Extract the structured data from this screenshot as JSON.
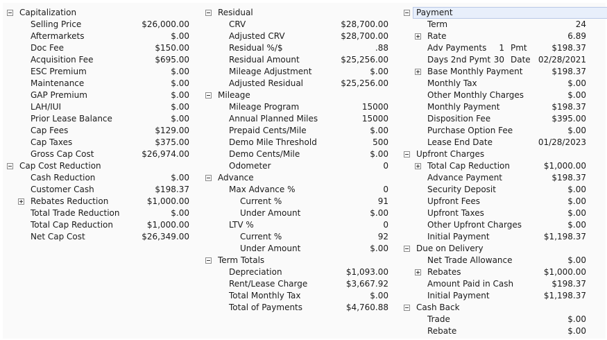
{
  "columns": [
    {
      "rows": [
        {
          "label": "Capitalization",
          "level": 0,
          "toggle": "minus"
        },
        {
          "label": "Selling Price",
          "value": "$26,000.00",
          "level": 1
        },
        {
          "label": "Aftermarkets",
          "value": "$.00",
          "level": 1
        },
        {
          "label": "Doc Fee",
          "value": "$150.00",
          "level": 1
        },
        {
          "label": "Acquisition Fee",
          "value": "$695.00",
          "level": 1
        },
        {
          "label": "ESC Premium",
          "value": "$.00",
          "level": 1
        },
        {
          "label": "Maintenance",
          "value": "$.00",
          "level": 1
        },
        {
          "label": "GAP Premium",
          "value": "$.00",
          "level": 1
        },
        {
          "label": "LAH/IUI",
          "value": "$.00",
          "level": 1
        },
        {
          "label": "Prior Lease Balance",
          "value": "$.00",
          "level": 1
        },
        {
          "label": "Cap Fees",
          "value": "$129.00",
          "level": 1
        },
        {
          "label": "Cap Taxes",
          "value": "$375.00",
          "level": 1
        },
        {
          "label": "Gross Cap Cost",
          "value": "$26,974.00",
          "level": 1
        },
        {
          "label": "Cap Cost Reduction",
          "level": 0,
          "toggle": "minus"
        },
        {
          "label": "Cash Reduction",
          "value": "$.00",
          "level": 1
        },
        {
          "label": "Customer Cash",
          "value": "$198.37",
          "level": 1
        },
        {
          "label": "Rebates Reduction",
          "value": "$1,000.00",
          "level": 1,
          "toggle": "plus"
        },
        {
          "label": "Total Trade Reduction",
          "value": "$.00",
          "level": 1
        },
        {
          "label": "Total Cap Reduction",
          "value": "$1,000.00",
          "level": 1
        },
        {
          "label": "Net Cap Cost",
          "value": "$26,349.00",
          "level": 1
        }
      ]
    },
    {
      "rows": [
        {
          "label": "Residual",
          "level": 0,
          "toggle": "minus"
        },
        {
          "label": "CRV",
          "value": "$28,700.00",
          "level": 1
        },
        {
          "label": "Adjusted CRV",
          "value": "$28,700.00",
          "level": 1
        },
        {
          "label": "Residual %/$",
          "value": ".88",
          "level": 1
        },
        {
          "label": "Residual Amount",
          "value": "$25,256.00",
          "level": 1
        },
        {
          "label": "Mileage Adjustment",
          "value": "$.00",
          "level": 1
        },
        {
          "label": "Adjusted Residual",
          "value": "$25,256.00",
          "level": 1
        },
        {
          "label": "Mileage",
          "level": 0,
          "toggle": "minus"
        },
        {
          "label": "Mileage Program",
          "value": "15000",
          "level": 1
        },
        {
          "label": "Annual Planned Miles",
          "value": "15000",
          "level": 1
        },
        {
          "label": "Prepaid Cents/Mile",
          "value": "$.00",
          "level": 1
        },
        {
          "label": "Demo Mile Threshold",
          "value": "500",
          "level": 1
        },
        {
          "label": "Demo Cents/Mile",
          "value": "$.00",
          "level": 1
        },
        {
          "label": "Odometer",
          "value": "0",
          "level": 1
        },
        {
          "label": "Advance",
          "level": 0,
          "toggle": "minus"
        },
        {
          "label": "Max Advance %",
          "value": "0",
          "level": 1
        },
        {
          "label": "Current %",
          "value": "91",
          "level": 2
        },
        {
          "label": "Under Amount",
          "value": "$.00",
          "level": 2
        },
        {
          "label": "LTV %",
          "value": "0",
          "level": 1
        },
        {
          "label": "Current %",
          "value": "92",
          "level": 2
        },
        {
          "label": "Under Amount",
          "value": "$.00",
          "level": 2
        },
        {
          "label": "Term Totals",
          "level": 0,
          "toggle": "minus"
        },
        {
          "label": "Depreciation",
          "value": "$1,093.00",
          "level": 1
        },
        {
          "label": "Rent/Lease Charge",
          "value": "$3,667.92",
          "level": 1
        },
        {
          "label": "Total Monthly Tax",
          "value": "$.00",
          "level": 1
        },
        {
          "label": "Total of Payments",
          "value": "$4,760.88",
          "level": 1
        }
      ]
    },
    {
      "rows": [
        {
          "label": "Payment",
          "level": 0,
          "toggle": "minus",
          "selected": true
        },
        {
          "label": "Term",
          "value": "24",
          "level": 1
        },
        {
          "label": "Rate",
          "value": "6.89",
          "level": 1,
          "toggle": "plus"
        },
        {
          "label": "Adv Payments",
          "mid_value": "1",
          "mid_label": "Pmt",
          "value": "$198.37",
          "level": 1
        },
        {
          "label": "Days 2nd Pymt",
          "mid_value": "30",
          "mid_label": "Date",
          "value": "02/28/2021",
          "level": 1
        },
        {
          "label": "Base Monthly Payment",
          "value": "$198.37",
          "level": 1,
          "toggle": "plus"
        },
        {
          "label": "Monthly Tax",
          "value": "$.00",
          "level": 1
        },
        {
          "label": "Other Monthly Charges",
          "value": "$.00",
          "level": 1
        },
        {
          "label": "Monthly Payment",
          "value": "$198.37",
          "level": 1
        },
        {
          "label": "Disposition Fee",
          "value": "$395.00",
          "level": 1
        },
        {
          "label": "Purchase Option Fee",
          "value": "$.00",
          "level": 1
        },
        {
          "label": "Lease End Date",
          "value": "01/28/2023",
          "level": 1
        },
        {
          "label": "Upfront Charges",
          "level": 0,
          "toggle": "minus"
        },
        {
          "label": "Total Cap Reduction",
          "value": "$1,000.00",
          "level": 1,
          "toggle": "plus"
        },
        {
          "label": "Advance Payment",
          "value": "$198.37",
          "level": 1
        },
        {
          "label": "Security Deposit",
          "value": "$.00",
          "level": 1
        },
        {
          "label": "Upfront Fees",
          "value": "$.00",
          "level": 1
        },
        {
          "label": "Upfront Taxes",
          "value": "$.00",
          "level": 1
        },
        {
          "label": "Other Upfront Charges",
          "value": "$.00",
          "level": 1
        },
        {
          "label": "Initial Payment",
          "value": "$1,198.37",
          "level": 1
        },
        {
          "label": "Due on Delivery",
          "level": 0,
          "toggle": "minus"
        },
        {
          "label": "Net Trade Allowance",
          "value": "$.00",
          "level": 1
        },
        {
          "label": "Rebates",
          "value": "$1,000.00",
          "level": 1,
          "toggle": "plus"
        },
        {
          "label": "Amount Paid in Cash",
          "value": "$198.37",
          "level": 1
        },
        {
          "label": "Initial Payment",
          "value": "$1,198.37",
          "level": 1
        },
        {
          "label": "Cash Back",
          "level": 0,
          "toggle": "minus"
        },
        {
          "label": "Trade",
          "value": "$.00",
          "level": 1
        },
        {
          "label": "Rebate",
          "value": "$.00",
          "level": 1
        }
      ]
    }
  ]
}
